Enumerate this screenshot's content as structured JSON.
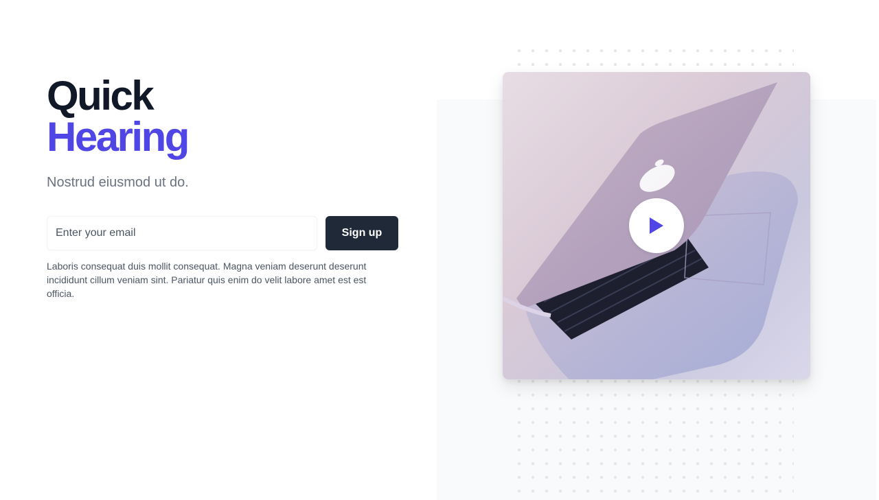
{
  "hero": {
    "title_line1": "Quick",
    "title_line2": "Hearing",
    "subtitle": "Nostrud eiusmod ut do.",
    "email_placeholder": "Enter your email",
    "email_value": "",
    "signup_label": "Sign up",
    "disclaimer": "Laboris consequat duis mollit consequat. Magna veniam deserunt deserunt incididunt cillum veniam sint. Pariatur quis enim do velit labore amet est est officia."
  },
  "media": {
    "image_subject": "laptop-photo",
    "play_icon": "play-icon"
  },
  "colors": {
    "accent": "#4f46e5",
    "title_dark": "#111827",
    "button_dark": "#1f2937",
    "panel_bg": "#f9fafb"
  }
}
